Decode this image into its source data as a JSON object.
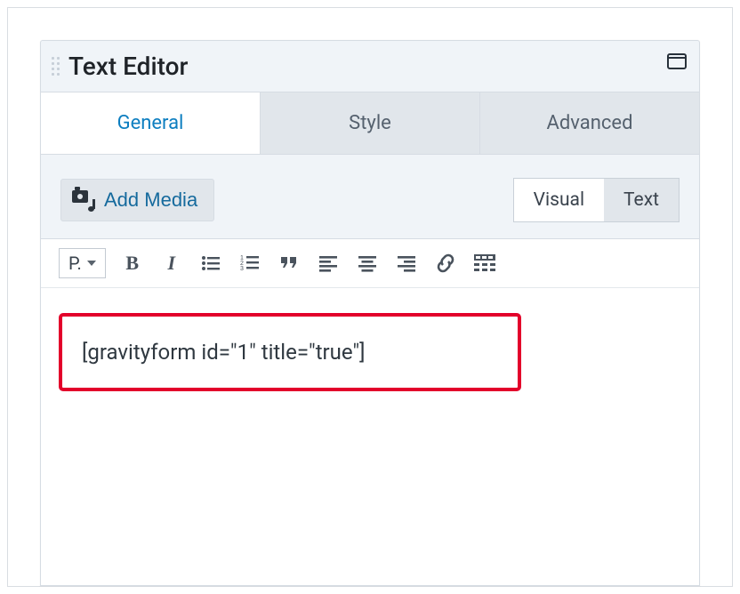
{
  "panel": {
    "title": "Text Editor"
  },
  "tabs": {
    "general": "General",
    "style": "Style",
    "advanced": "Advanced"
  },
  "toolbar": {
    "add_media": "Add Media",
    "visual": "Visual",
    "text": "Text"
  },
  "formatbar": {
    "paragraph": "P."
  },
  "content": {
    "shortcode": "[gravityform id=\"1\" title=\"true\"]"
  }
}
